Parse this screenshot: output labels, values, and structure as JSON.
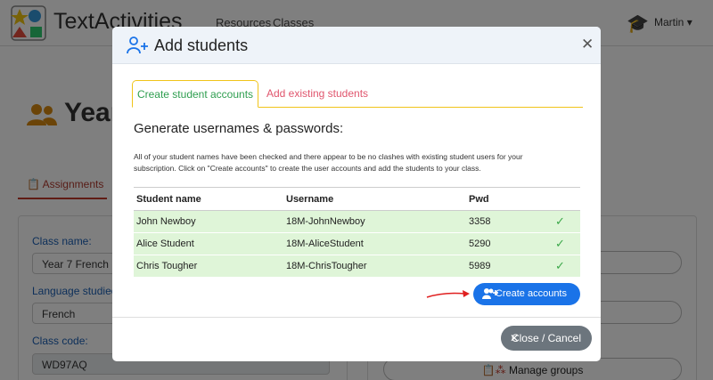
{
  "app": {
    "name": "TextActivities"
  },
  "nav": {
    "resources": "Resources",
    "classes": "Classes",
    "user": "Martin"
  },
  "page": {
    "heading": "Year",
    "assignments_tab": "Assignments"
  },
  "form": {
    "class_name_label": "Class name:",
    "class_name_value": "Year 7 French",
    "language_label": "Language studied:",
    "language_value": "French",
    "class_code_label": "Class code:",
    "class_code_value": "WD97AQ",
    "manage_groups": "Manage groups"
  },
  "modal": {
    "title": "Add students",
    "tabs": [
      "Create student accounts",
      "Add existing students"
    ],
    "subtitle": "Generate usernames & passwords:",
    "paragraph": "All of your student names have been checked and there appear to be no clashes with existing student users for your subscription. Click on \"Create accounts\" to create the user accounts and add the students to your class.",
    "columns": [
      "Student name",
      "Username",
      "Pwd"
    ],
    "rows": [
      {
        "name": "John Newboy",
        "username": "18M-JohnNewboy",
        "pwd": "3358"
      },
      {
        "name": "Alice Student",
        "username": "18M-AliceStudent",
        "pwd": "5290"
      },
      {
        "name": "Chris Tougher",
        "username": "18M-ChrisTougher",
        "pwd": "5989"
      }
    ],
    "create_button": "Create accounts",
    "close_button": "Close / Cancel"
  },
  "colors": {
    "primary": "#1a73e8",
    "success": "#3ca84a",
    "row_bg": "#dff5d8",
    "tab_border": "#f0c419",
    "tab_inactive": "#e0556d",
    "arrow": "#e02020"
  },
  "icons": [
    "logo-icon",
    "graduation-cap-icon",
    "caret-down-icon",
    "users-icon",
    "user-plus-icon",
    "close-icon",
    "check-icon",
    "arrow-icon",
    "clipboard-icon",
    "groups-icon"
  ]
}
